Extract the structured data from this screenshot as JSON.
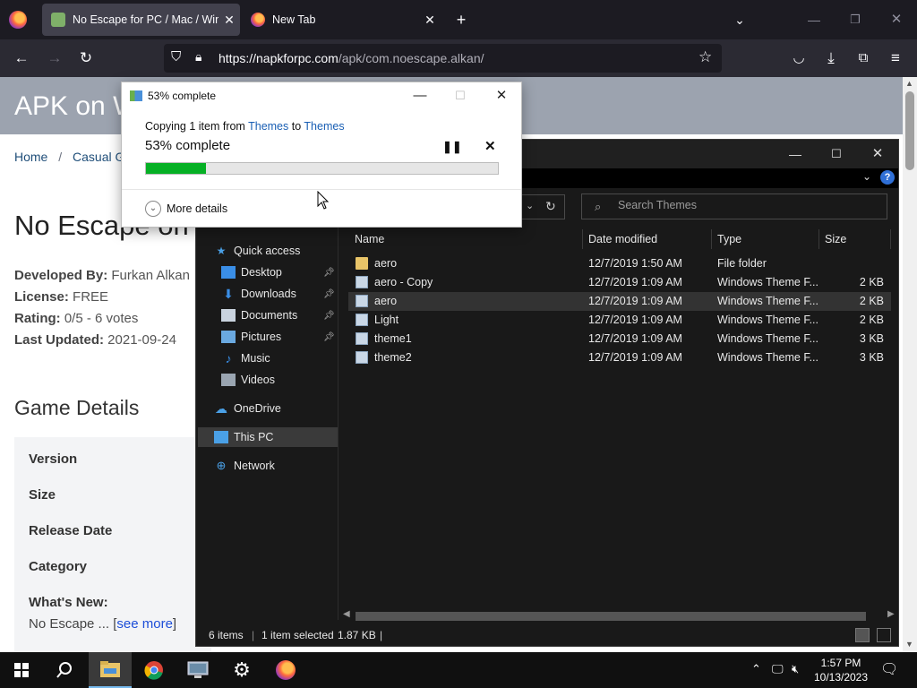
{
  "browser": {
    "tabs": [
      {
        "title": "No Escape for PC / Mac / Wind",
        "active": true
      },
      {
        "title": "New Tab",
        "active": false
      }
    ],
    "url": {
      "host": "https://napkforpc.com",
      "path": "/apk/com.noescape.alkan/"
    }
  },
  "page": {
    "hero_title": "APK on W",
    "breadcrumb": {
      "home": "Home",
      "sep": "/",
      "category": "Casual Gam"
    },
    "app_title": "No Escape on",
    "meta": [
      {
        "label": "Developed By:",
        "value": " Furkan Alkan"
      },
      {
        "label": "License:",
        "value": " FREE"
      },
      {
        "label": "Rating:",
        "value": " 0/5 - 6 votes"
      },
      {
        "label": "Last Updated:",
        "value": " 2021-09-24"
      }
    ],
    "details_heading": "Game Details",
    "details_rows": [
      "Version",
      "Size",
      "Release Date",
      "Category",
      "What's New:"
    ],
    "whats_new_text": "No Escape ... [",
    "see_more": "see more",
    "close_bracket": "]"
  },
  "explorer": {
    "search_placeholder": "Search Themes",
    "nav": [
      {
        "label": "Quick access",
        "icon": "star-icon",
        "color": "#4aa0e6"
      },
      {
        "label": "Desktop",
        "icon": "desktop-icon",
        "color": "#3a8ee6",
        "pinned": true
      },
      {
        "label": "Downloads",
        "icon": "download-icon",
        "color": "#3a8ee6",
        "pinned": true
      },
      {
        "label": "Documents",
        "icon": "documents-icon",
        "color": "#c9d3de",
        "pinned": true
      },
      {
        "label": "Pictures",
        "icon": "pictures-icon",
        "color": "#6aa9e0",
        "pinned": true
      },
      {
        "label": "Music",
        "icon": "music-icon",
        "color": "#3a8ee6"
      },
      {
        "label": "Videos",
        "icon": "videos-icon",
        "color": "#9aa5b1"
      },
      {
        "label": "OneDrive",
        "icon": "cloud-icon",
        "color": "#4aa0e6"
      },
      {
        "label": "This PC",
        "icon": "pc-icon",
        "color": "#4aa0e6",
        "selected": true
      },
      {
        "label": "Network",
        "icon": "network-icon",
        "color": "#4aa0e6"
      }
    ],
    "columns": [
      "Name",
      "Date modified",
      "Type",
      "Size"
    ],
    "files": [
      {
        "name": "aero",
        "date": "12/7/2019 1:50 AM",
        "type": "File folder",
        "size": "",
        "kind": "folder"
      },
      {
        "name": "aero - Copy",
        "date": "12/7/2019 1:09 AM",
        "type": "Windows Theme F...",
        "size": "2 KB",
        "kind": "theme"
      },
      {
        "name": "aero",
        "date": "12/7/2019 1:09 AM",
        "type": "Windows Theme F...",
        "size": "2 KB",
        "kind": "theme",
        "selected": true
      },
      {
        "name": "Light",
        "date": "12/7/2019 1:09 AM",
        "type": "Windows Theme F...",
        "size": "2 KB",
        "kind": "theme"
      },
      {
        "name": "theme1",
        "date": "12/7/2019 1:09 AM",
        "type": "Windows Theme F...",
        "size": "3 KB",
        "kind": "theme"
      },
      {
        "name": "theme2",
        "date": "12/7/2019 1:09 AM",
        "type": "Windows Theme F...",
        "size": "3 KB",
        "kind": "theme"
      }
    ],
    "status": {
      "items": "6 items",
      "selected": "1 item selected",
      "size": "1.87 KB"
    }
  },
  "copy_dialog": {
    "title": "53% complete",
    "copying_prefix": "Copying 1 item from ",
    "from": "Themes",
    "to_word": " to ",
    "to": "Themes",
    "progress_text": "53% complete",
    "progress": 0.17,
    "more_details": "More details"
  },
  "taskbar": {
    "time": "1:57 PM",
    "date": "10/13/2023"
  }
}
